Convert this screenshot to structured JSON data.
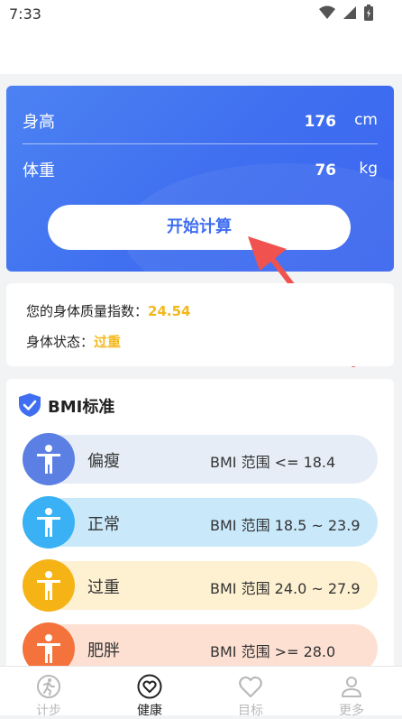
{
  "status_bar": {
    "time": "7:33"
  },
  "input_card": {
    "height_label": "身高",
    "height_value": "176",
    "height_unit": "cm",
    "weight_label": "体重",
    "weight_value": "76",
    "weight_unit": "kg",
    "calculate_button": "开始计算"
  },
  "result": {
    "bmi_label": "您的身体质量指数：",
    "bmi_value": "24.54",
    "status_label": "身体状态：",
    "status_value": "过重"
  },
  "standard": {
    "title": "BMI标准",
    "bands": [
      {
        "name": "偏瘦",
        "range": "BMI 范围 <= 18.4",
        "icon_color": "#5b7fe3",
        "bg": "#e7edf7"
      },
      {
        "name": "正常",
        "range": "BMI 范围 18.5 ~ 23.9",
        "icon_color": "#39b1f4",
        "bg": "#c9e9fb"
      },
      {
        "name": "过重",
        "range": "BMI 范围 24.0 ~ 27.9",
        "icon_color": "#f6b316",
        "bg": "#fdf1d1"
      },
      {
        "name": "肥胖",
        "range": "BMI 范围 >= 28.0",
        "icon_color": "#f4723c",
        "bg": "#fde0d2"
      }
    ]
  },
  "bottom_nav": [
    {
      "label": "计步",
      "icon": "run-icon"
    },
    {
      "label": "健康",
      "icon": "heart-circle-icon",
      "active": true
    },
    {
      "label": "目标",
      "icon": "heart-icon"
    },
    {
      "label": "更多",
      "icon": "person-icon"
    }
  ],
  "colors": {
    "primary": "#3f6ef0",
    "accent": "#f4b81c",
    "arrow": "#f0534f"
  }
}
